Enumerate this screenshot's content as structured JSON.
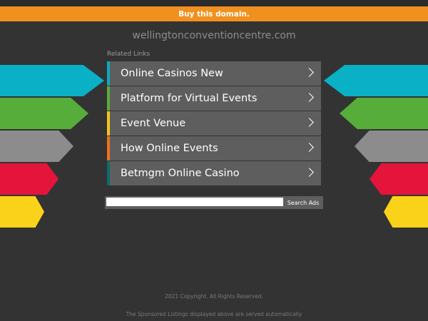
{
  "banner": {
    "label": "Buy this domain."
  },
  "site": {
    "domain": "wellingtonconventioncentre.com"
  },
  "related": {
    "title": "Related Links",
    "links": [
      {
        "label": "Online Casinos New",
        "color": "#0fa9bf"
      },
      {
        "label": "Platform for Virtual Events",
        "color": "#5aae3a"
      },
      {
        "label": "Event Venue",
        "color": "#f3c51c"
      },
      {
        "label": "How Online Events",
        "color": "#f0701f"
      },
      {
        "label": "Betmgm Online Casino",
        "color": "#0b6b6e"
      }
    ]
  },
  "decor": {
    "arrow_colors": [
      "#0ab0c6",
      "#57ad3a",
      "#8c8c8c",
      "#e4143a",
      "#fbd21a"
    ]
  },
  "search": {
    "placeholder": "",
    "button_label": "Search Ads"
  },
  "footer": {
    "copyright": "2021 Copyright. All Rights Reserved.",
    "disclaimer": "The Sponsored Listings displayed above are served automatically"
  }
}
